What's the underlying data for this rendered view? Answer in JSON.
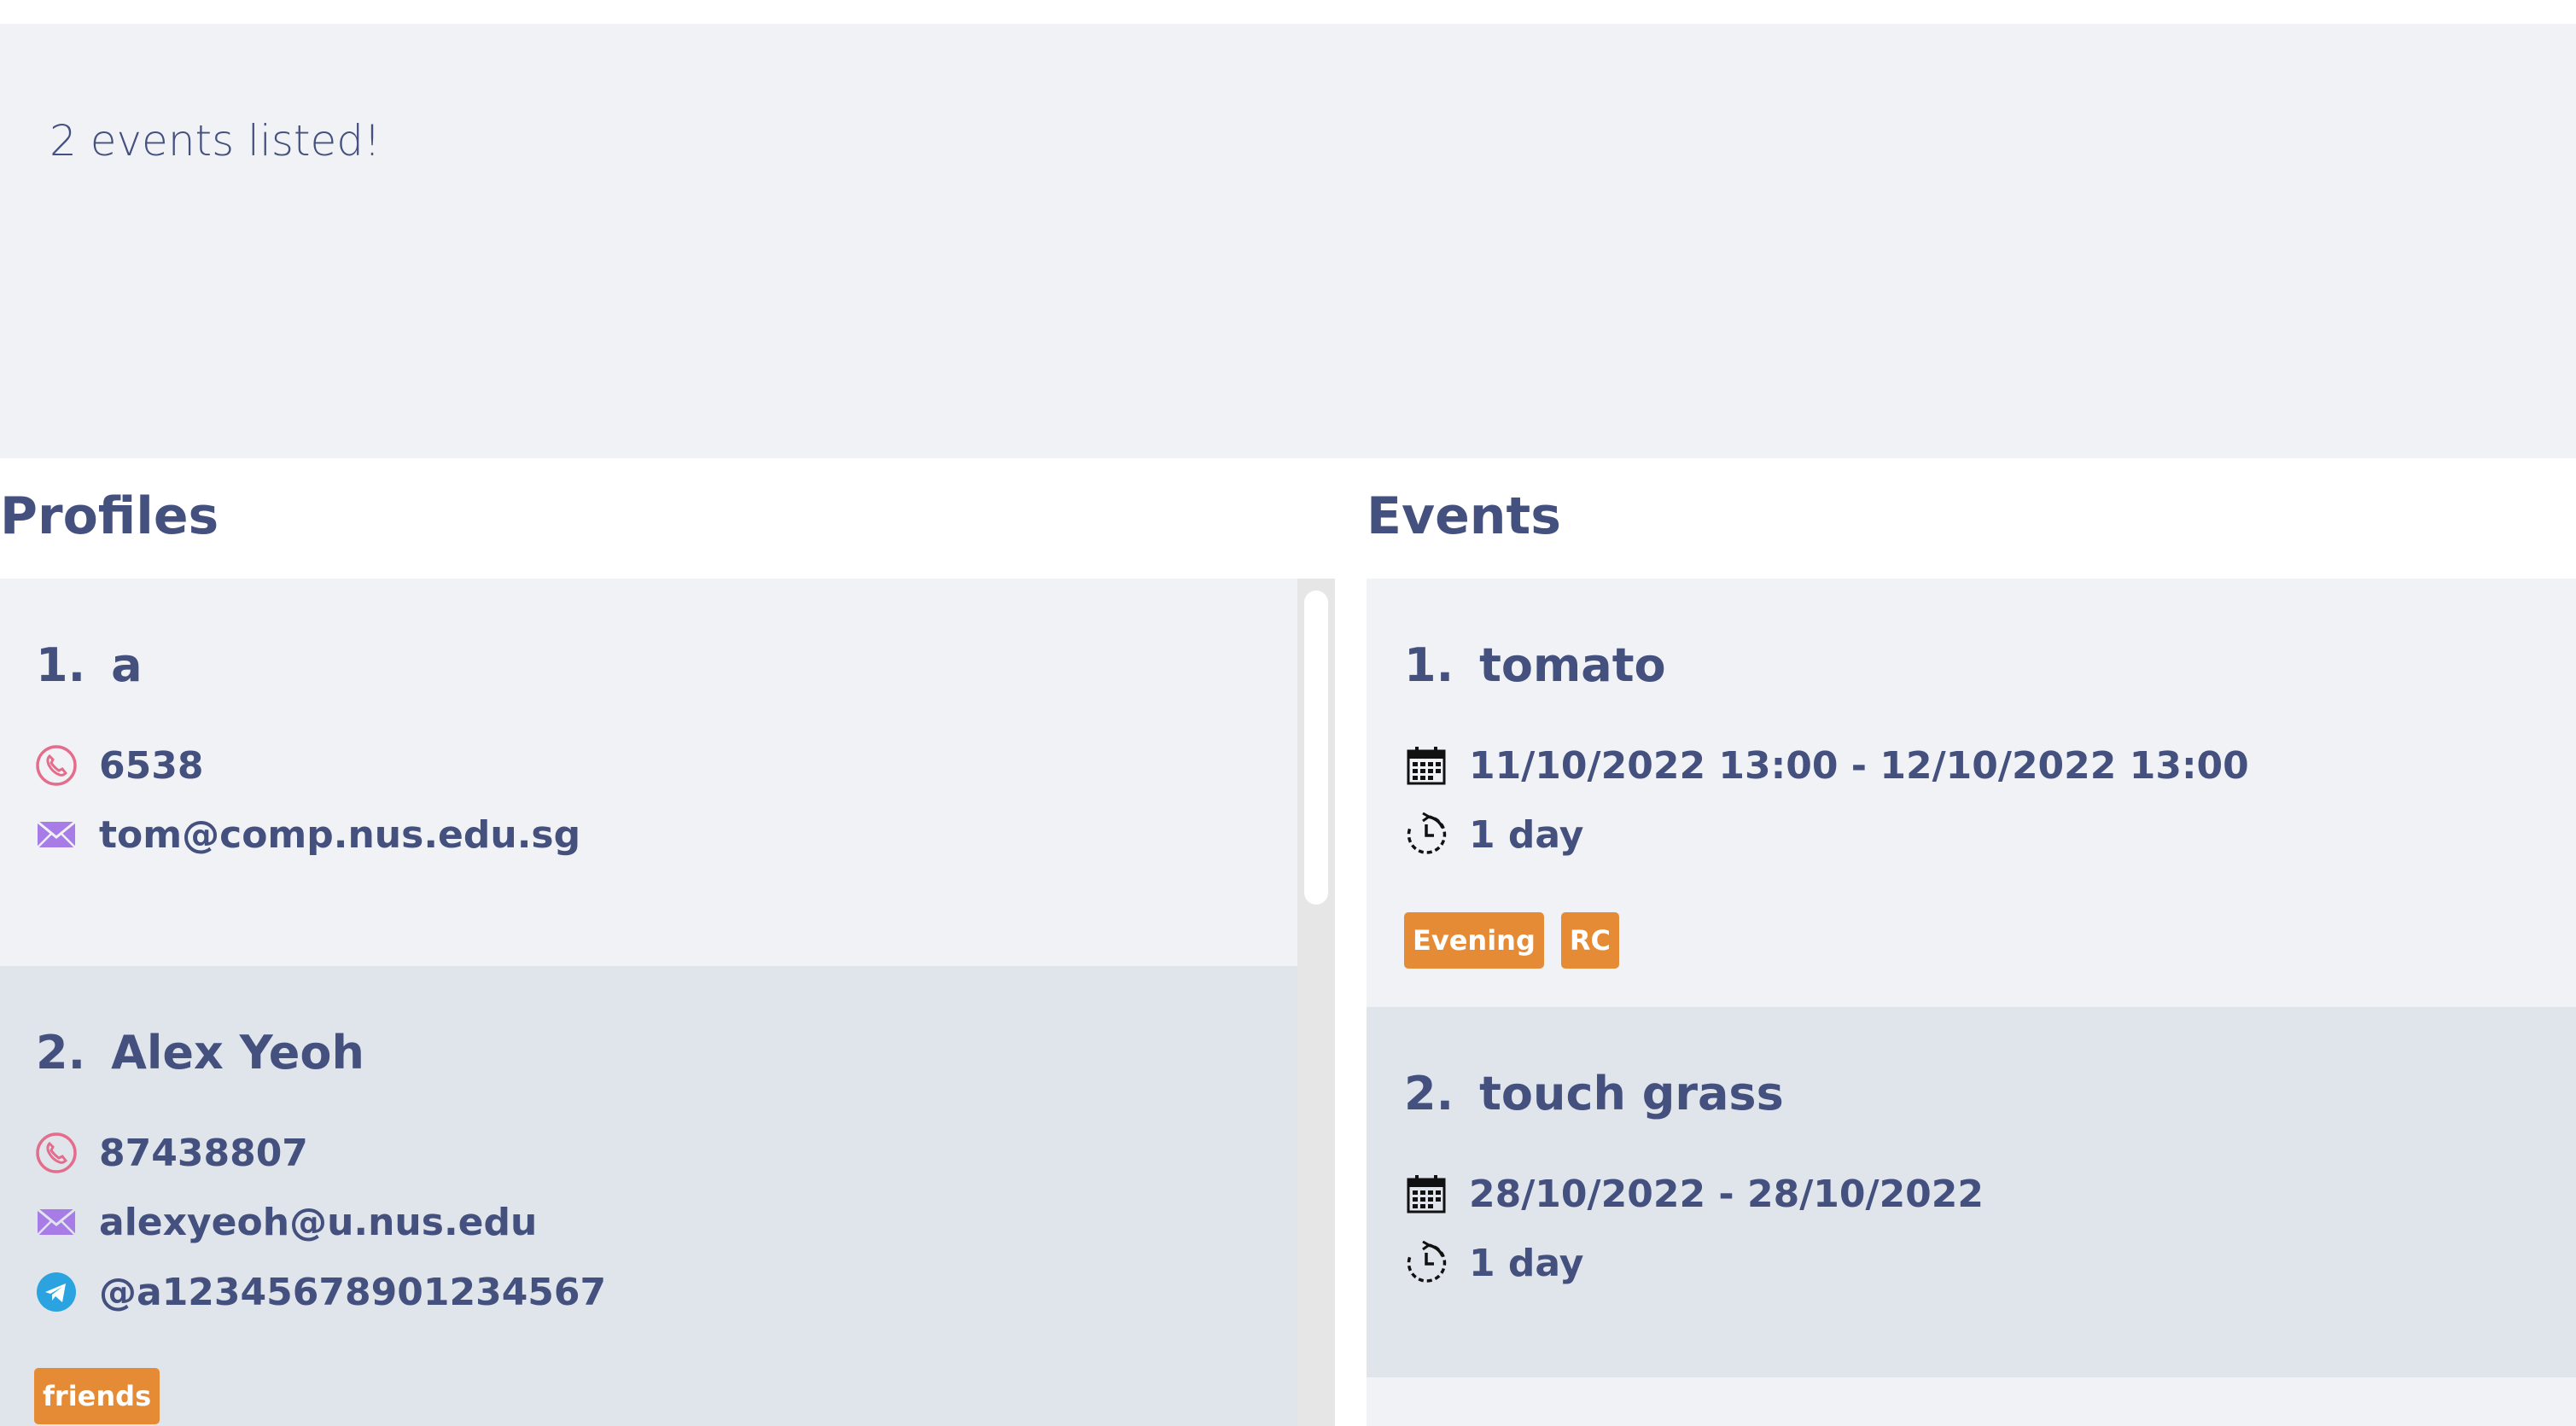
{
  "result": {
    "text": "2 events listed!"
  },
  "profiles": {
    "title": "Profiles",
    "items": [
      {
        "index": "1.",
        "name": "a",
        "phone": "6538",
        "email": "tom@comp.nus.edu.sg"
      },
      {
        "index": "2.",
        "name": "Alex Yeoh",
        "phone": "87438807",
        "email": "alexyeoh@u.nus.edu",
        "telegram": "@a12345678901234567",
        "tags": [
          "friends"
        ]
      }
    ]
  },
  "events": {
    "title": "Events",
    "items": [
      {
        "index": "1.",
        "name": "tomato",
        "datetime": "11/10/2022 13:00 - 12/10/2022 13:00",
        "duration": "1 day",
        "tags": [
          "Evening",
          "RC"
        ]
      },
      {
        "index": "2.",
        "name": "touch grass",
        "datetime": "28/10/2022 - 28/10/2022",
        "duration": "1 day"
      }
    ]
  },
  "icons": {
    "phone": "phone-icon",
    "email": "envelope-icon",
    "telegram": "telegram-icon",
    "calendar": "calendar-icon",
    "duration": "clock-icon"
  },
  "colors": {
    "text": "#44507e",
    "tag": "#e58b35",
    "phone_icon": "#e46d8c",
    "email_icon": "#a77ce6",
    "telegram_icon": "#2aa3e0",
    "card_odd": "#f0f2f5",
    "card_even": "#e0e4eb"
  }
}
